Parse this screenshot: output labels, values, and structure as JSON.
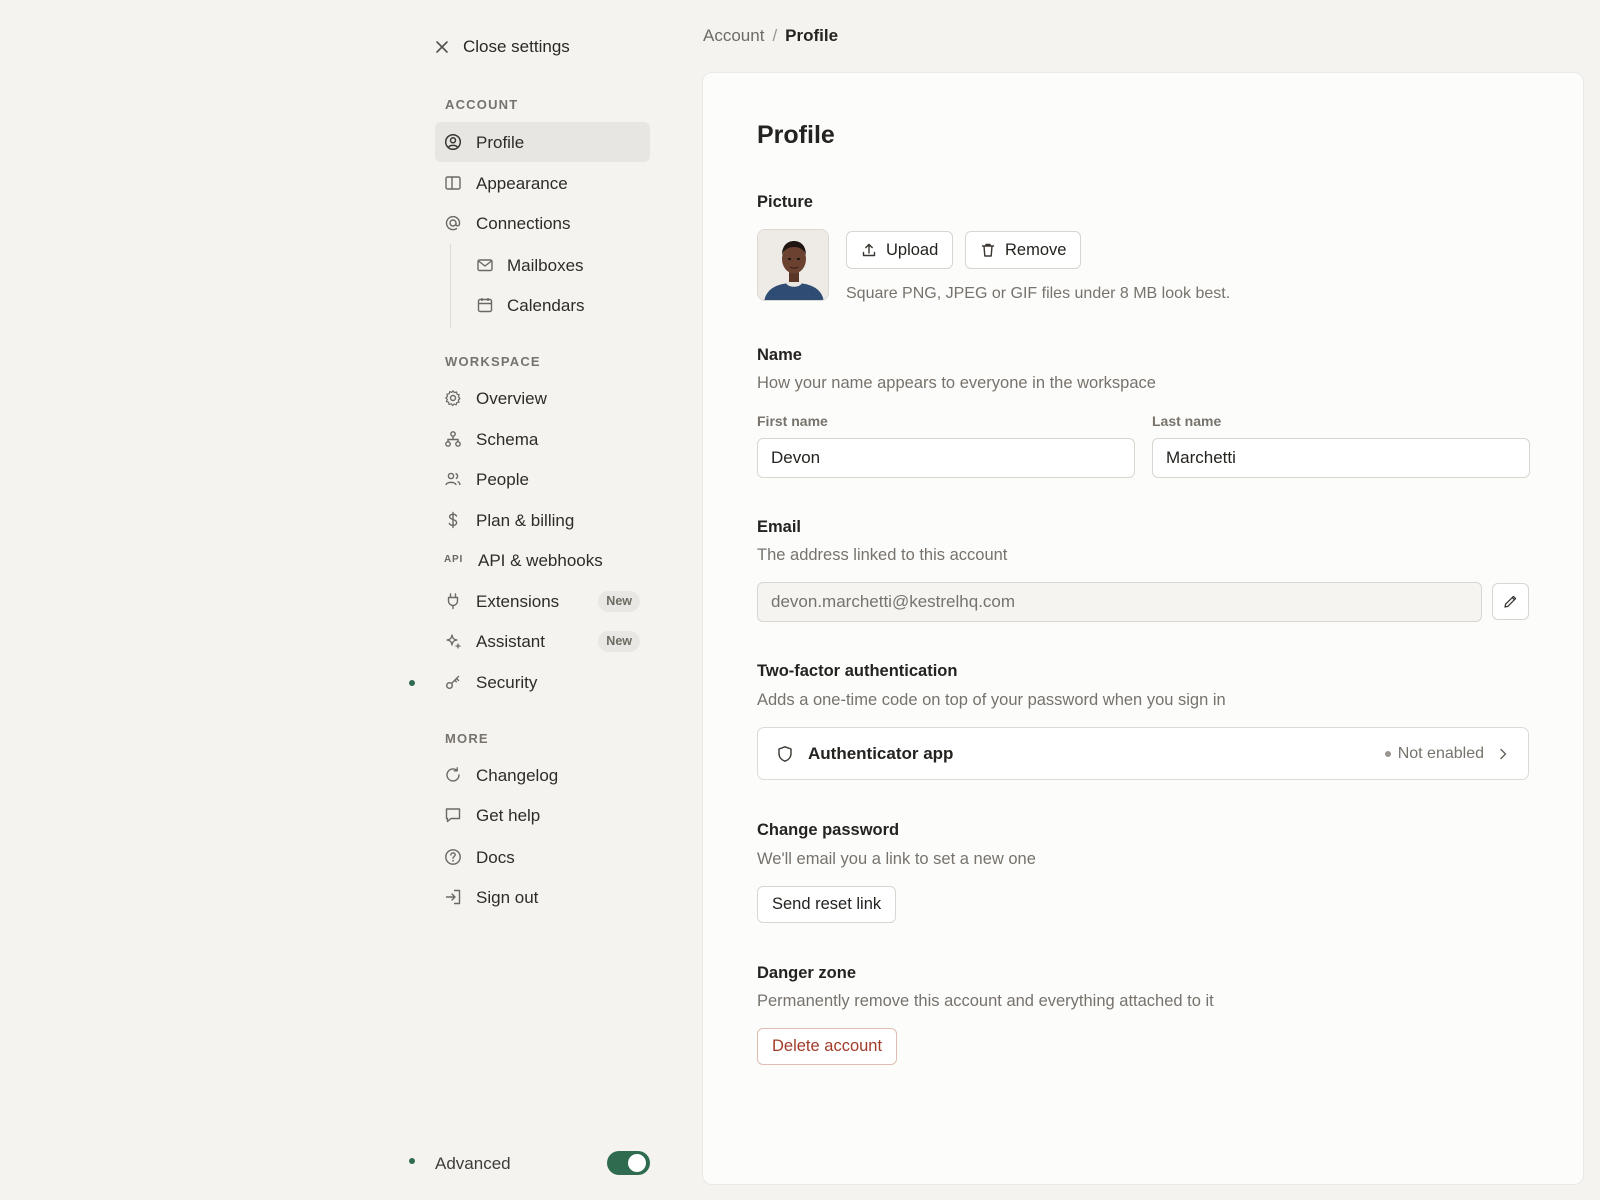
{
  "sidebar": {
    "close_label": "Close settings",
    "sections": {
      "account": "ACCOUNT",
      "workspace": "WORKSPACE",
      "more": "MORE"
    },
    "items": {
      "profile": "Profile",
      "appearance": "Appearance",
      "connections": "Connections",
      "mailboxes": "Mailboxes",
      "calendars": "Calendars",
      "overview": "Overview",
      "schema": "Schema",
      "people": "People",
      "billing": "Plan & billing",
      "api": "API & webhooks",
      "api_icon_text": "API",
      "extensions": "Extensions",
      "assistant": "Assistant",
      "security": "Security",
      "changelog": "Changelog",
      "get_help": "Get help",
      "docs": "Docs",
      "sign_out": "Sign out"
    },
    "badges": {
      "extensions": "New",
      "assistant": "New"
    },
    "active_item": "profile",
    "advanced_label": "Advanced",
    "advanced_enabled": true
  },
  "breadcrumb": {
    "parent": "Account",
    "separator": "/",
    "current": "Profile"
  },
  "profile": {
    "title": "Profile",
    "picture": {
      "label": "Picture",
      "upload_label": "Upload",
      "remove_label": "Remove",
      "hint": "Square PNG, JPEG or GIF files under 8 MB look best."
    },
    "name": {
      "label": "Name",
      "description": "How your name appears to everyone in the workspace",
      "first_label": "First name",
      "first_value": "Devon",
      "last_label": "Last name",
      "last_value": "Marchetti"
    },
    "email": {
      "label": "Email",
      "description": "The address linked to this account",
      "value": "devon.marchetti@kestrelhq.com"
    },
    "two_factor": {
      "label": "Two-factor authentication",
      "description": "Adds a one-time code on top of your password when you sign in",
      "method": "Authenticator app",
      "status": "Not enabled"
    },
    "password": {
      "label": "Change password",
      "description": "We'll email you a link to set a new one",
      "button": "Send reset link"
    },
    "danger": {
      "label": "Danger zone",
      "description": "Permanently remove this account and everything attached to it",
      "button": "Delete account"
    }
  },
  "colors": {
    "accent": "#2e6b4f",
    "danger": "#a13b2a",
    "background": "#f4f3f0",
    "panel": "#fcfcfb"
  },
  "icons": {
    "close": "close-icon",
    "profile": "user-circle-icon",
    "appearance": "panel-icon",
    "connections": "at-sign-icon",
    "mailboxes": "mail-icon",
    "calendars": "calendar-icon",
    "overview": "gear-icon",
    "schema": "schema-icon",
    "people": "people-icon",
    "billing": "dollar-icon",
    "extensions": "plug-icon",
    "assistant": "sparkle-icon",
    "security": "key-icon",
    "changelog": "refresh-icon",
    "get_help": "chat-icon",
    "docs": "help-circle-icon",
    "sign_out": "sign-out-icon",
    "upload": "upload-icon",
    "remove": "trash-icon",
    "edit": "pencil-icon",
    "shield": "shield-icon",
    "chevron": "chevron-right-icon"
  }
}
